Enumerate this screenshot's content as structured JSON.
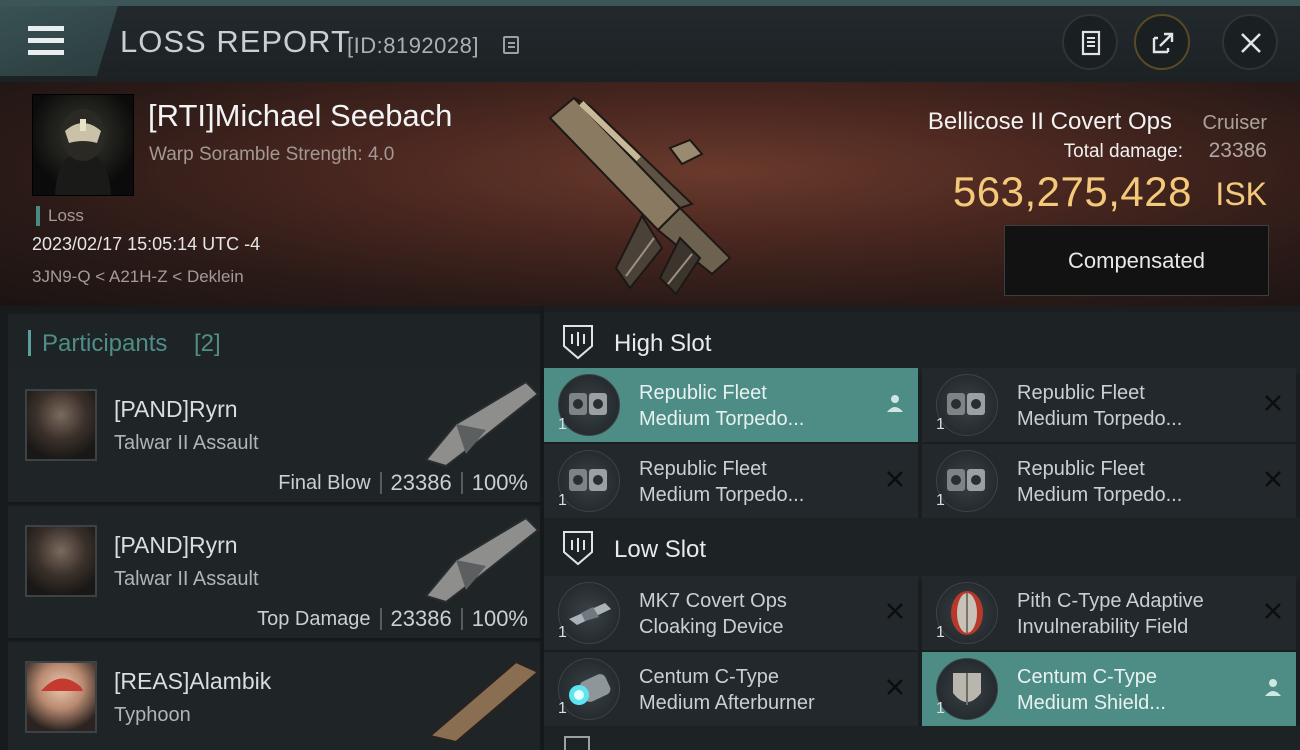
{
  "header": {
    "title": "LOSS REPORT",
    "report_id": "[ID:8192028]",
    "icons": [
      "menu-icon",
      "copy-icon",
      "clipboard-icon",
      "share-icon",
      "close-icon"
    ]
  },
  "victim": {
    "name": "[RTI]Michael Seebach",
    "warp_scramble": "Warp Soramble Strength: 4.0",
    "tag": "Loss",
    "datetime": "2023/02/17 15:05:14 UTC -4",
    "location": "3JN9-Q < A21H-Z < Deklein",
    "ship_name": "Bellicose II Covert Ops",
    "ship_class": "Cruiser",
    "total_damage_label": "Total damage:",
    "total_damage": "23386",
    "isk_value": "563,275,428",
    "isk_unit": "ISK",
    "compensation": "Compensated"
  },
  "participants": {
    "title": "Participants",
    "count": "[2]",
    "rows": [
      {
        "name": "[PAND]Ryrn",
        "ship": "Talwar II Assault",
        "role": "Final Blow",
        "damage": "23386",
        "percent": "100%"
      },
      {
        "name": "[PAND]Ryrn",
        "ship": "Talwar II Assault",
        "role": "Top Damage",
        "damage": "23386",
        "percent": "100%"
      },
      {
        "name": "[REAS]Alambik",
        "ship": "Typhoon",
        "role": "",
        "damage": "",
        "percent": ""
      }
    ]
  },
  "fitting": {
    "high_slot": {
      "label": "High Slot",
      "modules": [
        {
          "line1": "Republic Fleet",
          "line2": "Medium Torpedo...",
          "qty": "1",
          "status": "person-icon",
          "highlighted": true
        },
        {
          "line1": "Republic Fleet",
          "line2": "Medium Torpedo...",
          "qty": "1",
          "status": "x-icon",
          "highlighted": false
        },
        {
          "line1": "Republic Fleet",
          "line2": "Medium Torpedo...",
          "qty": "1",
          "status": "x-icon",
          "highlighted": false
        },
        {
          "line1": "Republic Fleet",
          "line2": "Medium Torpedo...",
          "qty": "1",
          "status": "x-icon",
          "highlighted": false
        }
      ]
    },
    "low_slot": {
      "label": "Low Slot",
      "modules": [
        {
          "line1": "MK7 Covert Ops",
          "line2": "Cloaking Device",
          "qty": "1",
          "status": "x-icon",
          "highlighted": false
        },
        {
          "line1": "Pith C-Type Adaptive",
          "line2": "Invulnerability Field",
          "qty": "1",
          "status": "x-icon",
          "highlighted": false
        },
        {
          "line1": "Centum C-Type",
          "line2": "Medium Afterburner",
          "qty": "1",
          "status": "x-icon",
          "highlighted": false
        },
        {
          "line1": "Centum C-Type",
          "line2": "Medium Shield...",
          "qty": "1",
          "status": "person-icon",
          "highlighted": true
        }
      ]
    }
  },
  "colors": {
    "accent_teal": "#4d8d86",
    "isk_gold": "#f4c97a"
  }
}
